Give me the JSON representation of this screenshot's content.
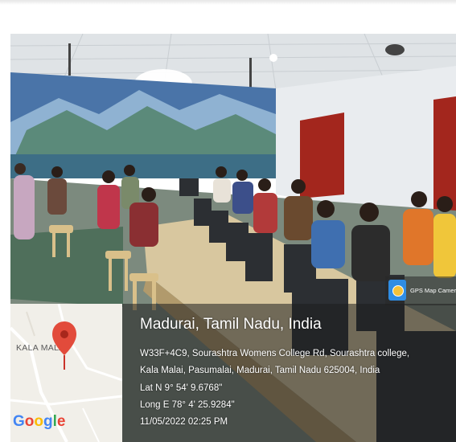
{
  "location": {
    "title": "Madurai, Tamil Nadu, India",
    "address_line1": "W33F+4C9, Sourashtra Womens College Rd, Sourashtra college,",
    "address_line2": "Kala Malai, Pasumalai, Madurai, Tamil Nadu 625004, India",
    "latitude": "Lat N 9° 54' 9.6768\"",
    "longitude": "Long E 78° 4' 25.9284\"",
    "timestamp": "11/05/2022 02:25 PM"
  },
  "map": {
    "place_label": "KALA MALAI",
    "provider": "Google",
    "pin_color": "#e24b3b"
  },
  "badge": {
    "app_name": "GPS Map Camera"
  }
}
